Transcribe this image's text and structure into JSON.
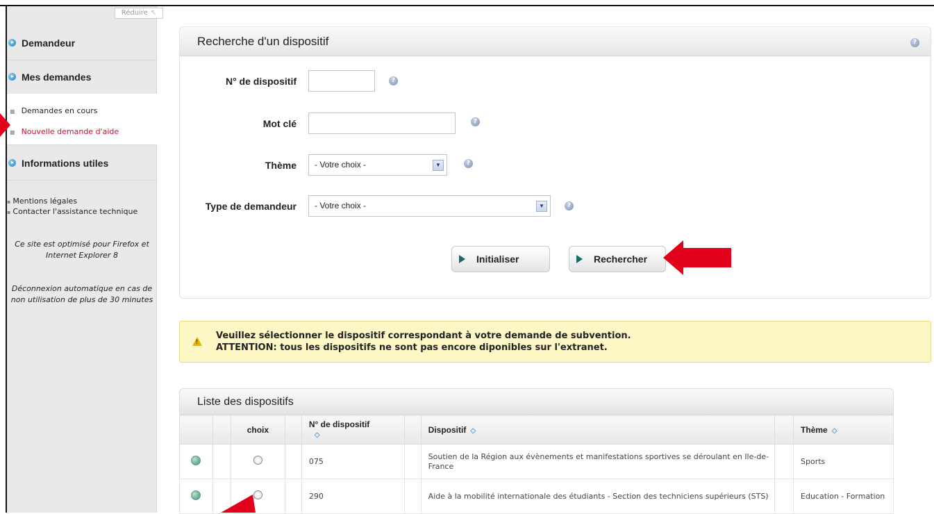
{
  "sidebar": {
    "reduce_label": "Réduire",
    "sections": [
      {
        "label": "Demandeur"
      },
      {
        "label": "Mes demandes"
      },
      {
        "label": "Informations utiles"
      }
    ],
    "subitems": [
      {
        "label": "Demandes en cours"
      },
      {
        "label": "Nouvelle demande d'aide"
      }
    ],
    "links": [
      {
        "label": "Mentions légales"
      },
      {
        "label": "Contacter l'assistance technique"
      }
    ],
    "note_browser_1": "Ce site est optimisé pour Firefox et",
    "note_browser_2": "Internet Explorer 8",
    "note_logout_1": "Déconnexion automatique en cas de",
    "note_logout_2": "non utilisation de plus de 30 minutes"
  },
  "search": {
    "title": "Recherche d'un dispositif",
    "fields": {
      "numero_label": "N° de dispositif",
      "numero_value": "",
      "motcle_label": "Mot clé",
      "motcle_value": "",
      "theme_label": "Thème",
      "theme_value": "- Votre choix -",
      "type_label": "Type de demandeur",
      "type_value": "- Votre choix -"
    },
    "buttons": {
      "reset_label": "Initialiser",
      "search_label": "Rechercher"
    }
  },
  "warning": {
    "line1": "Veuillez sélectionner le dispositif correspondant à votre demande de subvention.",
    "line2": "ATTENTION: tous les dispositifs ne sont pas encore diponibles sur l'extranet."
  },
  "list": {
    "title": "Liste des dispositifs",
    "columns": {
      "choix": "choix",
      "numero": "N° de dispositif",
      "dispositif": "Dispositif",
      "theme": "Thème"
    },
    "rows": [
      {
        "numero": "075",
        "dispositif": "Soutien de la Région aux évènements et manifestations sportives se déroulant en Ile-de-France",
        "theme": "Sports"
      },
      {
        "numero": "290",
        "dispositif": "Aide à la mobilité internationale des étudiants - Section des techniciens supérieurs (STS)",
        "theme": "Education - Formation"
      }
    ]
  },
  "colors": {
    "active_link": "#c8102e",
    "annotation_arrow": "#e3001b",
    "warning_bg": "#fdf7c6",
    "bullet_blue": "#1f7fc0"
  }
}
